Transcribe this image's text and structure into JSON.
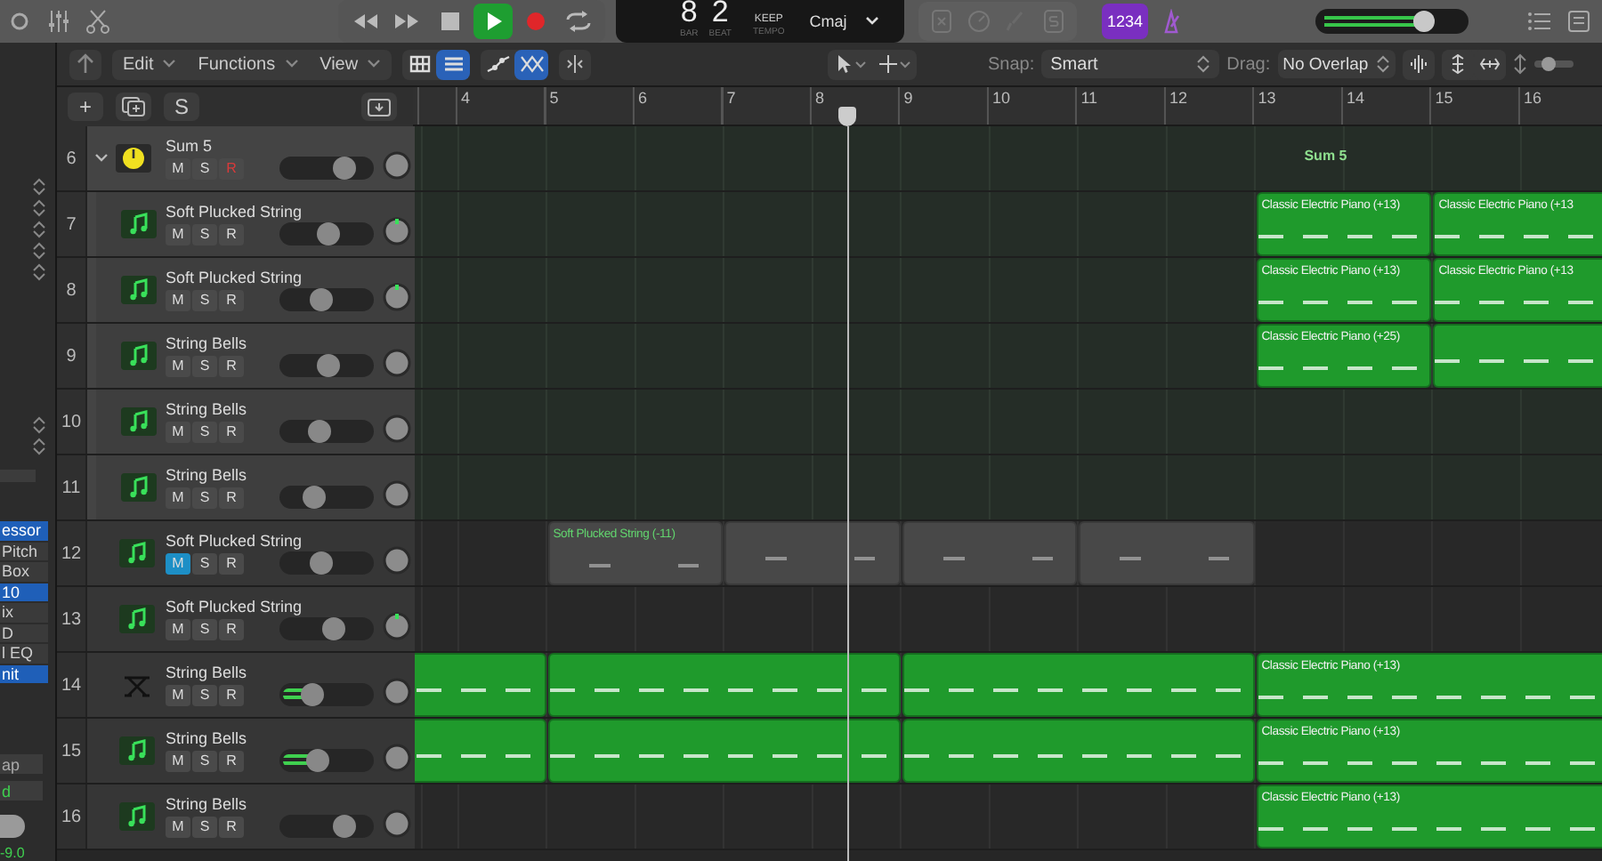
{
  "control_bar": {
    "transport": [
      {
        "kind": "rewind",
        "on": false
      },
      {
        "kind": "forward",
        "on": false
      },
      {
        "kind": "stop",
        "on": false
      },
      {
        "kind": "play",
        "on": true
      },
      {
        "kind": "record",
        "on": false
      },
      {
        "kind": "cycle",
        "on": false
      }
    ],
    "lcd": {
      "bar": "8",
      "bar_label": "BAR",
      "beat": "2",
      "beat_label": "BEAT",
      "tempo": "KEEP",
      "tempo_label": "TEMPO",
      "key": "Cmaj"
    },
    "count_in": {
      "label": "1234",
      "on": true
    },
    "master_volume": {
      "level": 0.74
    }
  },
  "inspector": {
    "slots": [
      {
        "label": "essor",
        "selected": true
      },
      {
        "label": "Pitch",
        "selected": false
      },
      {
        "label": "Box",
        "selected": false
      },
      {
        "label": "10",
        "selected": true
      },
      {
        "label": "ix",
        "selected": false
      },
      {
        "label": "D",
        "selected": false
      },
      {
        "label": "l EQ",
        "selected": false
      },
      {
        "label": "nit",
        "selected": true
      }
    ],
    "buttons": [
      {
        "label": "ap",
        "on": false
      },
      {
        "label": "d",
        "on": true
      }
    ],
    "readout": "-9.0"
  },
  "toolbar": {
    "menus": [
      "Edit",
      "Functions",
      "View"
    ],
    "view_buttons": [
      {
        "kind": "grid",
        "selected": false
      },
      {
        "kind": "list",
        "selected": true
      }
    ],
    "automation_buttons": [
      {
        "kind": "curve",
        "selected": false
      },
      {
        "kind": "flex",
        "selected": true
      }
    ],
    "snap_label": "Snap:",
    "snap": "Smart",
    "drag_label": "Drag:",
    "drag": "No Overlap",
    "zoom": {
      "level": 0.4
    }
  },
  "track_buttons": {
    "add": "+",
    "solo": "S"
  },
  "ruler": {
    "bars": [
      "4",
      "5",
      "6",
      "7",
      "8",
      "9",
      "10",
      "11",
      "12",
      "13",
      "14",
      "15",
      "16"
    ]
  },
  "tracks": [
    {
      "number": "6",
      "name": "Sum 5",
      "kind": "stack",
      "expanded": true,
      "mute": {
        "label": "M",
        "on": false
      },
      "solo": {
        "label": "S",
        "on": false
      },
      "record": {
        "label": "R",
        "on": true
      },
      "meter": false,
      "pan_mark": false,
      "volume": {
        "level": 0.7
      },
      "regions": [
        {
          "kind": "label",
          "title": "Sum 5"
        }
      ],
      "children": [
        {
          "number": "7",
          "name": "Soft Plucked String",
          "kind": "instrument",
          "mute": {
            "label": "M",
            "on": false
          },
          "solo": {
            "label": "S",
            "on": false
          },
          "record": {
            "label": "R",
            "on": false
          },
          "meter": false,
          "pan_mark": true,
          "volume": {
            "level": 0.52
          },
          "regions": [
            {
              "kind": "midi",
              "title": "Classic Electric Piano (+13)"
            },
            {
              "kind": "midi",
              "title": "Classic Electric Piano (+13"
            }
          ]
        },
        {
          "number": "8",
          "name": "Soft Plucked String",
          "kind": "instrument",
          "mute": {
            "label": "M",
            "on": false
          },
          "solo": {
            "label": "S",
            "on": false
          },
          "record": {
            "label": "R",
            "on": false
          },
          "meter": false,
          "pan_mark": true,
          "volume": {
            "level": 0.45
          },
          "regions": [
            {
              "kind": "midi",
              "title": "Classic Electric Piano (+13)"
            },
            {
              "kind": "midi",
              "title": "Classic Electric Piano (+13"
            }
          ]
        },
        {
          "number": "9",
          "name": "String Bells",
          "kind": "instrument",
          "mute": {
            "label": "M",
            "on": false
          },
          "solo": {
            "label": "S",
            "on": false
          },
          "record": {
            "label": "R",
            "on": false
          },
          "meter": false,
          "pan_mark": false,
          "volume": {
            "level": 0.53
          },
          "regions": [
            {
              "kind": "midi",
              "title": "Classic Electric Piano (+25)"
            },
            {
              "kind": "midi"
            }
          ]
        },
        {
          "number": "10",
          "name": "String Bells",
          "kind": "instrument",
          "mute": {
            "label": "M",
            "on": false
          },
          "solo": {
            "label": "S",
            "on": false
          },
          "record": {
            "label": "R",
            "on": false
          },
          "meter": false,
          "pan_mark": false,
          "volume": {
            "level": 0.44
          }
        },
        {
          "number": "11",
          "name": "String Bells",
          "kind": "instrument",
          "mute": {
            "label": "M",
            "on": false
          },
          "solo": {
            "label": "S",
            "on": false
          },
          "record": {
            "label": "R",
            "on": false
          },
          "meter": false,
          "pan_mark": false,
          "volume": {
            "level": 0.38
          }
        }
      ]
    },
    {
      "number": "12",
      "name": "Soft Plucked String",
      "kind": "instrument",
      "mute": {
        "label": "M",
        "on": true
      },
      "solo": {
        "label": "S",
        "on": false
      },
      "record": {
        "label": "R",
        "on": false
      },
      "meter": false,
      "pan_mark": false,
      "volume": {
        "level": 0.45
      },
      "regions": [
        {
          "kind": "muted",
          "title": "Soft Plucked String (-11)"
        },
        {
          "kind": "muted"
        },
        {
          "kind": "muted"
        },
        {
          "kind": "muted"
        }
      ]
    },
    {
      "number": "13",
      "name": "Soft Plucked String",
      "kind": "instrument",
      "mute": {
        "label": "M",
        "on": false
      },
      "solo": {
        "label": "S",
        "on": false
      },
      "record": {
        "label": "R",
        "on": false
      },
      "meter": false,
      "pan_mark": true,
      "volume": {
        "level": 0.58
      }
    },
    {
      "number": "14",
      "name": "String Bells",
      "kind": "keyboard",
      "mute": {
        "label": "M",
        "on": false
      },
      "solo": {
        "label": "S",
        "on": false
      },
      "record": {
        "label": "R",
        "on": false
      },
      "meter": true,
      "pan_mark": false,
      "volume": {
        "level": 0.35
      },
      "regions": [
        {
          "kind": "midi"
        },
        {
          "kind": "midi"
        },
        {
          "kind": "midi"
        },
        {
          "kind": "midi",
          "title": "Classic Electric Piano (+13)"
        }
      ]
    },
    {
      "number": "15",
      "name": "String Bells",
      "kind": "instrument",
      "mute": {
        "label": "M",
        "on": false
      },
      "solo": {
        "label": "S",
        "on": false
      },
      "record": {
        "label": "R",
        "on": false
      },
      "meter": true,
      "pan_mark": false,
      "volume": {
        "level": 0.42
      },
      "regions": [
        {
          "kind": "midi"
        },
        {
          "kind": "midi"
        },
        {
          "kind": "midi"
        },
        {
          "kind": "midi",
          "title": "Classic Electric Piano (+13)"
        }
      ]
    },
    {
      "number": "16",
      "name": "String Bells",
      "kind": "instrument",
      "mute": {
        "label": "M",
        "on": false
      },
      "solo": {
        "label": "S",
        "on": false
      },
      "record": {
        "label": "R",
        "on": false
      },
      "meter": false,
      "pan_mark": false,
      "volume": {
        "level": 0.7
      },
      "regions": [
        {
          "kind": "midi",
          "title": "Classic Electric Piano (+13)"
        }
      ]
    }
  ]
}
